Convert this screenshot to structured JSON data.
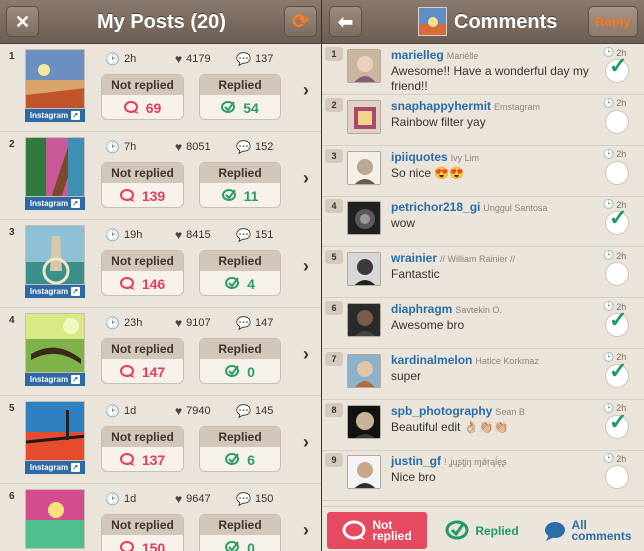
{
  "left": {
    "title": "My Posts (20)",
    "close_icon": "close-icon",
    "refresh_icon": "refresh-icon",
    "posts": [
      {
        "num": "1",
        "age": "2h",
        "likes": "4179",
        "comments": "137",
        "not_replied_label": "Not replied",
        "not_replied": "69",
        "replied_label": "Replied",
        "replied": "54",
        "badge": "Instagram"
      },
      {
        "num": "2",
        "age": "7h",
        "likes": "8051",
        "comments": "152",
        "not_replied_label": "Not replied",
        "not_replied": "139",
        "replied_label": "Replied",
        "replied": "11",
        "badge": "Instagram"
      },
      {
        "num": "3",
        "age": "19h",
        "likes": "8415",
        "comments": "151",
        "not_replied_label": "Not replied",
        "not_replied": "146",
        "replied_label": "Replied",
        "replied": "4",
        "badge": "Instagram"
      },
      {
        "num": "4",
        "age": "23h",
        "likes": "9107",
        "comments": "147",
        "not_replied_label": "Not replied",
        "not_replied": "147",
        "replied_label": "Replied",
        "replied": "0",
        "badge": "Instagram"
      },
      {
        "num": "5",
        "age": "1d",
        "likes": "7940",
        "comments": "145",
        "not_replied_label": "Not replied",
        "not_replied": "137",
        "replied_label": "Replied",
        "replied": "6",
        "badge": "Instagram"
      },
      {
        "num": "6",
        "age": "1d",
        "likes": "9647",
        "comments": "150",
        "not_replied_label": "Not replied",
        "not_replied": "150",
        "replied_label": "Replied",
        "replied": "0",
        "badge": ""
      }
    ]
  },
  "right": {
    "title": "Comments",
    "reply_label": "Reply",
    "comments": [
      {
        "num": "1",
        "user": "marielleg",
        "real": "Mariëlle",
        "text": "Awesome!! Have a wonderful day my friend!!",
        "age": "2h",
        "replied": true
      },
      {
        "num": "2",
        "user": "snaphappyhermit",
        "real": "Emstagram",
        "text": "Rainbow filter yay",
        "age": "2h",
        "replied": false
      },
      {
        "num": "3",
        "user": "ipiiquotes",
        "real": "Ivy Lim",
        "text": "So nice 😍😍",
        "age": "2h",
        "replied": false
      },
      {
        "num": "4",
        "user": "petrichor218_gi",
        "real": "Unggul Santosa",
        "text": "wow",
        "age": "2h",
        "replied": true
      },
      {
        "num": "5",
        "user": "wrainier",
        "real": "// William Rainier //",
        "text": "Fantastic",
        "age": "2h",
        "replied": false
      },
      {
        "num": "6",
        "user": "diaphragm",
        "real": "Savtekin O.",
        "text": "Awesome bro",
        "age": "2h",
        "replied": true
      },
      {
        "num": "7",
        "user": "kardinalmelon",
        "real": "Hatice Korkmaz",
        "text": "super",
        "age": "2h",
        "replied": true
      },
      {
        "num": "8",
        "user": "spb_photography",
        "real": "Sean B ",
        "text": "Beautiful edit 👌🏼👏🏼👏🏼",
        "age": "2h",
        "replied": true
      },
      {
        "num": "9",
        "user": "justin_gf",
        "real": "! ʝųʂţįŋ ɱǿŗąĺęʂ",
        "text": "Nice bro",
        "age": "2h",
        "replied": false
      }
    ],
    "tabs": {
      "not_replied_l1": "Not",
      "not_replied_l2": "replied",
      "replied": "Replied",
      "all_l1": "All",
      "all_l2": "comments"
    }
  },
  "colors": {
    "accent_red": "#e83b5f",
    "accent_green": "#2d9d68",
    "accent_blue": "#2a6ea8",
    "reply_orange": "#f07a1f"
  }
}
